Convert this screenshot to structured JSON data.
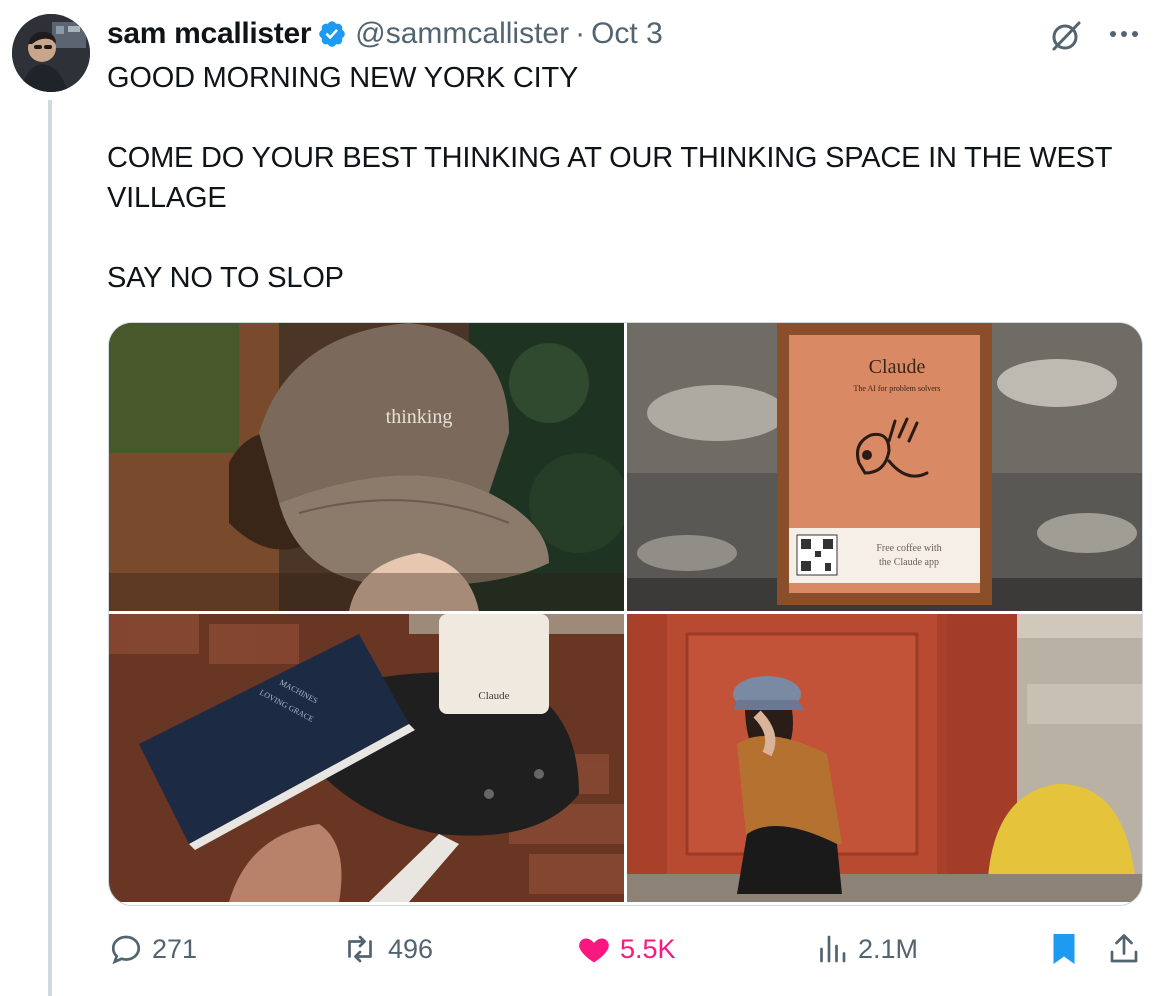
{
  "author": {
    "name": "sam mcallister",
    "handle": "@sammcallister",
    "separator": "·",
    "date": "Oct 3",
    "verified_color": "#1d9bf0"
  },
  "tweet": {
    "paragraphs": [
      "GOOD MORNING NEW YORK CITY",
      "COME DO YOUR BEST THINKING AT OUR THINKING SPACE IN THE WEST VILLAGE",
      "SAY NO TO SLOP"
    ]
  },
  "media": {
    "photos": [
      {
        "description_icon": "image",
        "printed_text": "thinking"
      },
      {
        "description_icon": "image",
        "printed_text": [
          "Claude",
          "The AI for problem solvers",
          "Free coffee with",
          "the Claude app"
        ]
      },
      {
        "description_icon": "image",
        "printed_text": [
          "MACHINES",
          "of",
          "LOVING GRACE",
          "Claude"
        ]
      },
      {
        "description_icon": "image",
        "printed_text": []
      }
    ]
  },
  "actions": {
    "replies": "271",
    "reposts": "496",
    "likes": "5.5K",
    "views": "2.1M",
    "liked": true,
    "bookmarked": true,
    "like_color": "#f91880",
    "bookmark_color": "#1d9bf0",
    "muted_color": "#536471"
  },
  "icons": [
    "grok-icon",
    "more-icon",
    "reply-icon",
    "retweet-icon",
    "heart-icon",
    "views-icon",
    "bookmark-icon",
    "share-icon",
    "verified-badge-icon"
  ]
}
